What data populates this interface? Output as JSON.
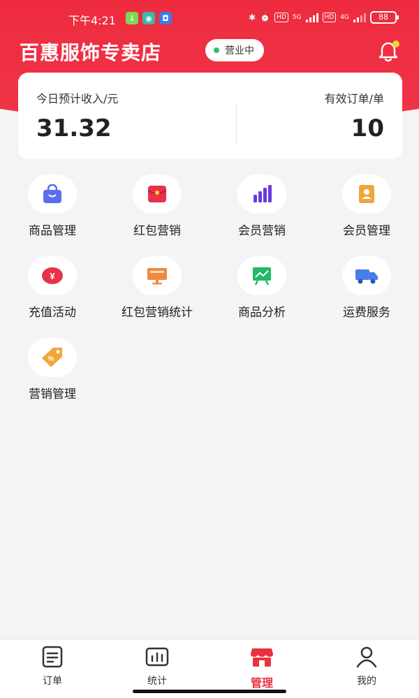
{
  "status_bar": {
    "time": "下午4:21",
    "battery": "88",
    "net1": "5G",
    "net2": "4G",
    "hd": "HD"
  },
  "store": {
    "name": "百惠服饰专卖店",
    "status": "营业中"
  },
  "stats": {
    "income_label": "今日预计收入/元",
    "income_value": "31.32",
    "orders_label": "有效订单/单",
    "orders_value": "10"
  },
  "menu": [
    {
      "label": "商品管理",
      "icon": "shopping-bag-icon",
      "color": "#5b6cf0"
    },
    {
      "label": "红包营销",
      "icon": "red-envelope-icon",
      "color": "#e8324a"
    },
    {
      "label": "会员营销",
      "icon": "bar-chart-icon",
      "color": "#6a3be0"
    },
    {
      "label": "会员管理",
      "icon": "contact-book-icon",
      "color": "#f0a63a"
    },
    {
      "label": "充值活动",
      "icon": "yuan-coin-icon",
      "color": "#e8324a"
    },
    {
      "label": "红包营销统计",
      "icon": "monitor-icon",
      "color": "#f08a3a"
    },
    {
      "label": "商品分析",
      "icon": "trend-board-icon",
      "color": "#22b86a"
    },
    {
      "label": "运费服务",
      "icon": "truck-icon",
      "color": "#4a7de8"
    },
    {
      "label": "营销管理",
      "icon": "discount-tag-icon",
      "color": "#f0a63a"
    }
  ],
  "tabs": [
    {
      "label": "订单",
      "icon": "order-list-icon"
    },
    {
      "label": "统计",
      "icon": "stats-icon"
    },
    {
      "label": "管理",
      "icon": "store-icon",
      "active": true
    },
    {
      "label": "我的",
      "icon": "profile-icon"
    }
  ],
  "colors": {
    "brand_red": "#ee2b3e",
    "active_tab": "#e8323f",
    "open_dot": "#2dbf6c"
  }
}
